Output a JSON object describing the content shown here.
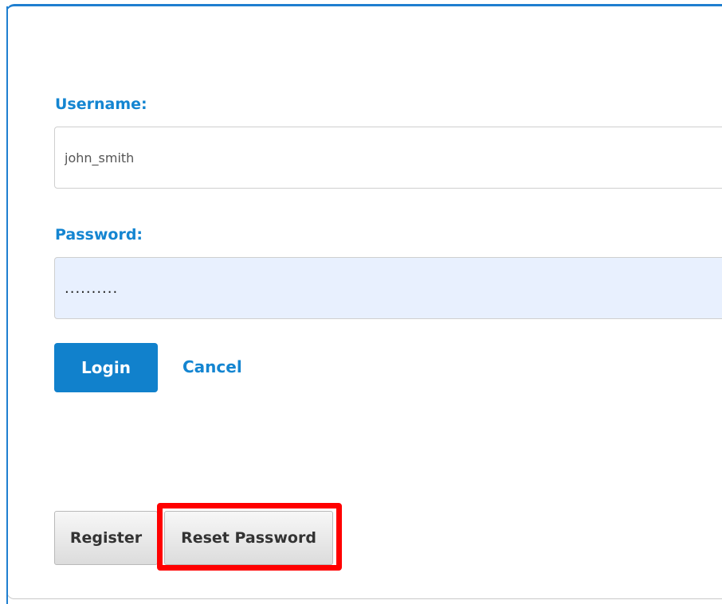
{
  "form": {
    "username_label": "Username:",
    "username_value": "john_smith",
    "password_label": "Password:",
    "password_value": "..........",
    "login_label": "Login",
    "cancel_label": "Cancel"
  },
  "footer": {
    "register_label": "Register",
    "reset_password_label": "Reset Password"
  },
  "colors": {
    "accent": "#1485d1",
    "login_button": "#1181cc",
    "password_field_bg": "#e8f0fe",
    "highlight": "#ff0000"
  }
}
